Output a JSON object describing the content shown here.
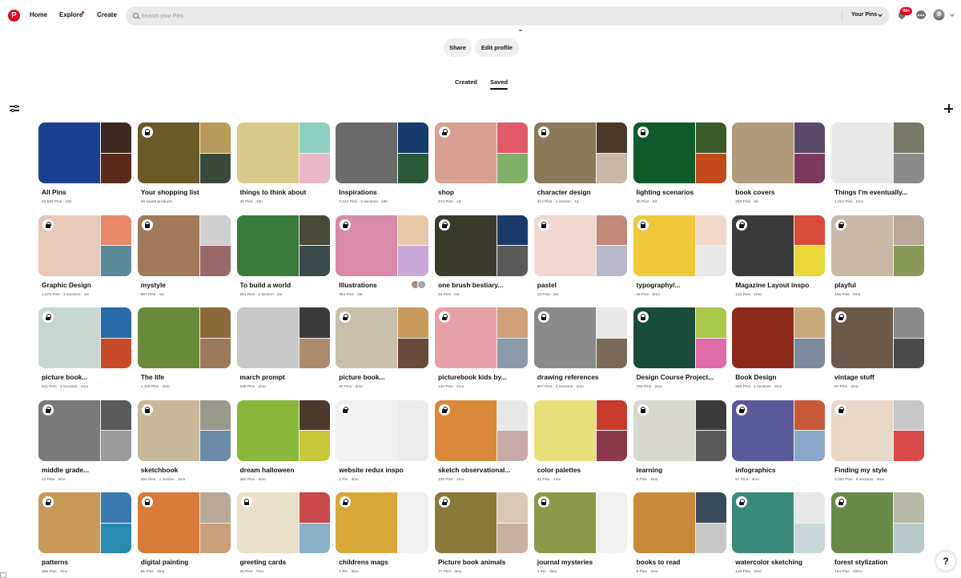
{
  "header": {
    "logo": "P",
    "nav": [
      {
        "label": "Home"
      },
      {
        "label": "Explore"
      },
      {
        "label": "Create"
      }
    ],
    "search_placeholder": "Search your Pins",
    "search_scope": "Your Pins",
    "notification_count": "99+",
    "brand_color": "#e60023"
  },
  "profile": {
    "share_label": "Share",
    "edit_label": "Edit profile",
    "tabs": [
      {
        "label": "Created"
      },
      {
        "label": "Saved"
      }
    ],
    "active_tab": "Saved"
  },
  "boards": [
    {
      "name": "All Pins",
      "meta": "22,632 Pins · 15h",
      "colors": [
        "#1b3f8f",
        "#3b2a1f",
        "#5a2a1a"
      ],
      "lock": false
    },
    {
      "name": "Your shopping list",
      "meta": "48 saved products",
      "colors": [
        "#6a5a2a",
        "#b89a5a",
        "#3a4a3a"
      ],
      "lock": true
    },
    {
      "name": "things to think about",
      "meta": "49 Pins · 15h",
      "colors": [
        "#d7c98a",
        "#8fd0c0",
        "#e8b8c8"
      ],
      "lock": false
    },
    {
      "name": "Inspirations",
      "meta": "7,613 Pins · 3 sections · 15h",
      "colors": [
        "#6a6a6a",
        "#163a6a",
        "#2a5a3a"
      ],
      "lock": false
    },
    {
      "name": "shop",
      "meta": "473 Pins · 1d",
      "colors": [
        "#d8a090",
        "#e05a6a",
        "#7fb06a"
      ],
      "lock": true
    },
    {
      "name": "character design",
      "meta": "314 Pins · 1 section · 1d",
      "colors": [
        "#8a7a5a",
        "#4a3a2a",
        "#c8b8a8"
      ],
      "lock": true
    },
    {
      "name": "lighting scenarios",
      "meta": "30 Pins · 3d",
      "colors": [
        "#0f5a2a",
        "#3a5a2a",
        "#c04a1a"
      ],
      "lock": true
    },
    {
      "name": "book covers",
      "meta": "303 Pins · 3d",
      "colors": [
        "#b09a7a",
        "#5a4a6a",
        "#7a3a5a"
      ],
      "lock": false
    },
    {
      "name": "Things I'm eventually...",
      "meta": "1,012 Pins · 5mo",
      "colors": [
        "#e8e8e8",
        "#7a7a6a",
        "#8a8a8a"
      ],
      "lock": false
    },
    {
      "name": "Graphic Design",
      "meta": "1,172 Pins · 3 sections · 1w",
      "colors": [
        "#e8c8b8",
        "#e88a6a",
        "#5a8a9a"
      ],
      "lock": true
    },
    {
      "name": "mystyle",
      "meta": "987 Pins · 1w",
      "colors": [
        "#a07a5a",
        "#cfcfcf",
        "#9a6a6a"
      ],
      "lock": true
    },
    {
      "name": "To build a world",
      "meta": "251 Pins · 1 section · 1w",
      "colors": [
        "#3a7a3a",
        "#4a4a3a",
        "#3a4a4a"
      ],
      "lock": false
    },
    {
      "name": "Illustrations",
      "meta": "364 Pins · 3w",
      "colors": [
        "#d88aa8",
        "#e8c8a8",
        "#c8a8d8"
      ],
      "lock": true,
      "collab": true
    },
    {
      "name": "one brush bestiary...",
      "meta": "10 Pins · 2w",
      "colors": [
        "#3a3a2a",
        "#1a3a6a",
        "#5a5a5a"
      ],
      "lock": true
    },
    {
      "name": "pastel",
      "meta": "23 Pins · 3w",
      "colors": [
        "#f0d8d0",
        "#c08a7a",
        "#b8b8c8"
      ],
      "lock": true
    },
    {
      "name": "typography/...",
      "meta": "45 Pins · 5mo",
      "colors": [
        "#f0c83a",
        "#f2d8c8",
        "#e8e8e8"
      ],
      "lock": true
    },
    {
      "name": "Magazine Layout inspo",
      "meta": "132 Pins · 1mo",
      "colors": [
        "#3a3a3a",
        "#d84a3a",
        "#e8d83a"
      ],
      "lock": true
    },
    {
      "name": "playful",
      "meta": "165 Pins · 5mo",
      "colors": [
        "#c8b8a8",
        "#b8a898",
        "#8a9a5a"
      ],
      "lock": true
    },
    {
      "name": "picture book...",
      "meta": "521 Pins · 3 sections · 2mo",
      "colors": [
        "#c8d8d0",
        "#2a6aa8",
        "#c84a2a"
      ],
      "lock": true
    },
    {
      "name": "The life",
      "meta": "1,118 Pins · 2mo",
      "colors": [
        "#6a8a3a",
        "#8a6a3a",
        "#9a7a5a"
      ],
      "lock": false
    },
    {
      "name": "march prompt",
      "meta": "108 Pins · 2mo",
      "colors": [
        "#c8c8c8",
        "#3a3a3a",
        "#aa8a6a"
      ],
      "lock": false
    },
    {
      "name": "picture book...",
      "meta": "37 Pins · 2mo",
      "colors": [
        "#c8c0a8",
        "#c89a5a",
        "#6a4a3a"
      ],
      "lock": true
    },
    {
      "name": "picturebook kids by...",
      "meta": "140 Pins · 2mo",
      "colors": [
        "#e8a0a8",
        "#d0a07a",
        "#8a9aa8"
      ],
      "lock": true
    },
    {
      "name": "drawing references",
      "meta": "507 Pins · 3 sections · 2mo",
      "colors": [
        "#8a8a8a",
        "#e8e8e8",
        "#7a6a5a"
      ],
      "lock": true
    },
    {
      "name": "Design Course Project...",
      "meta": "748 Pins · 2mo",
      "colors": [
        "#1a4a3a",
        "#a8c84a",
        "#e06aa8"
      ],
      "lock": true
    },
    {
      "name": "Book Design",
      "meta": "295 Pins · 2 sections · 2mo",
      "colors": [
        "#8a2a1a",
        "#c8a87a",
        "#7a8a9a"
      ],
      "lock": false
    },
    {
      "name": "vintage stuff",
      "meta": "97 Pins · 3mo",
      "colors": [
        "#6a5a4a",
        "#8a8a8a",
        "#4a4a4a"
      ],
      "lock": true
    },
    {
      "name": "middle grade...",
      "meta": "44 Pins · 3mo",
      "colors": [
        "#7a7a7a",
        "#5a5a5a",
        "#9a9a9a"
      ],
      "lock": true
    },
    {
      "name": "sketchbook",
      "meta": "264 Pins · 1 section · 3mo",
      "colors": [
        "#c8b89a",
        "#9a9a8a",
        "#6a8aa8"
      ],
      "lock": true
    },
    {
      "name": "dream halloween",
      "meta": "282 Pins · 3mo",
      "colors": [
        "#8ab83a",
        "#4a3a2a",
        "#c8c83a"
      ],
      "lock": false
    },
    {
      "name": "website redux inspo",
      "meta": "1 Pin · 3mo",
      "colors": [
        "#f0f0f0",
        "#ececec",
        "#ececec"
      ],
      "lock": true
    },
    {
      "name": "sketch observational...",
      "meta": "106 Pins · 3mo",
      "colors": [
        "#d88a3a",
        "#e8e8e8",
        "#c8a8a8"
      ],
      "lock": true
    },
    {
      "name": "color palettes",
      "meta": "31 Pins · 4mo",
      "colors": [
        "#e8e07a",
        "#c83a2a",
        "#8a3a4a"
      ],
      "lock": false
    },
    {
      "name": "learning",
      "meta": "6 Pins · 4mo",
      "colors": [
        "#d8d8d0",
        "#3a3a3a",
        "#5a5a5a"
      ],
      "lock": true
    },
    {
      "name": "infographics",
      "meta": "57 Pins · 3mo",
      "colors": [
        "#5a5a9a",
        "#c85a3a",
        "#8aa8c8"
      ],
      "lock": true
    },
    {
      "name": "Finding my style",
      "meta": "2,026 Pins · 6 sections · 3mo",
      "colors": [
        "#e8d8c8",
        "#c8c8c8",
        "#d84a4a"
      ],
      "lock": true
    },
    {
      "name": "patterns",
      "meta": "556 Pins · 4mo",
      "colors": [
        "#c89a5a",
        "#3a7ab0",
        "#2a8ab0"
      ],
      "lock": true
    },
    {
      "name": "digital painting",
      "meta": "51 Pins · 3mo",
      "colors": [
        "#d87a3a",
        "#b8a898",
        "#c8a07a"
      ],
      "lock": true
    },
    {
      "name": "greeting cards",
      "meta": "26 Pins · 7mo",
      "colors": [
        "#e8e0c8",
        "#c84a4a",
        "#8ab0c8"
      ],
      "lock": true
    },
    {
      "name": "childrens mags",
      "meta": "1 Pin · 3mo",
      "colors": [
        "#d8a83a",
        "#f0f0f0",
        "#f0f0f0"
      ],
      "lock": true
    },
    {
      "name": "Picture book animals",
      "meta": "17 Pins · 3mo",
      "colors": [
        "#8a7a3a",
        "#d8c8b8",
        "#c8b0a0"
      ],
      "lock": true
    },
    {
      "name": "journal mysteries",
      "meta": "1 Pin · 3mo",
      "colors": [
        "#8a9a4a",
        "#f0f0f0",
        "#f0f0f0"
      ],
      "lock": true
    },
    {
      "name": "books to read",
      "meta": "8 Pins · 3mo",
      "colors": [
        "#c88a3a",
        "#3a4a5a",
        "#c8c8c8"
      ],
      "lock": false
    },
    {
      "name": "watercolor sketching",
      "meta": "132 Pins · 3mo",
      "colors": [
        "#3a8a7a",
        "#e8e8e8",
        "#c8d8d8"
      ],
      "lock": true
    },
    {
      "name": "forest stylization",
      "meta": "164 Pins · 10mo",
      "colors": [
        "#6a8a4a",
        "#b8b8a8",
        "#b8c8c8"
      ],
      "lock": true
    }
  ],
  "help_label": "?"
}
